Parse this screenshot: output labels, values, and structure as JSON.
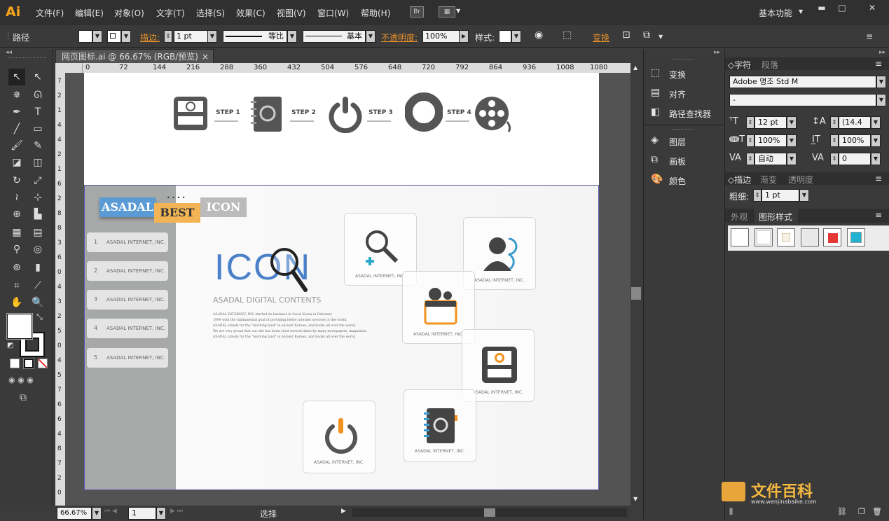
{
  "app": {
    "logo": "Ai"
  },
  "menu": [
    "文件(F)",
    "编辑(E)",
    "对象(O)",
    "文字(T)",
    "选择(S)",
    "效果(C)",
    "视图(V)",
    "窗口(W)",
    "帮助(H)"
  ],
  "toolbar_top": {
    "br": "Br",
    "workspace": "基本功能"
  },
  "control": {
    "selection": "路径",
    "stroke_label": "描边:",
    "stroke_value": "1 pt",
    "stroke_profile": "等比",
    "brush": "基本",
    "opacity_label": "不透明度:",
    "opacity_value": "100%",
    "style_label": "样式:",
    "transform": "变换"
  },
  "document": {
    "tab": "网页图标.ai @ 66.67% (RGB/预览)",
    "close": "×"
  },
  "ruler": {
    "h": [
      "0",
      "72",
      "144",
      "216",
      "288",
      "360",
      "432",
      "504",
      "576",
      "648",
      "720",
      "792",
      "864",
      "936",
      "1008",
      "1080"
    ],
    "v": [
      "7",
      "2",
      "1",
      "4",
      "4",
      "2",
      "1",
      "6",
      "2",
      "8",
      "8",
      "3",
      "6",
      "0",
      "4",
      "3",
      "2",
      "5",
      "0",
      "4",
      "5",
      "7",
      "6",
      "6",
      "4",
      "8",
      "7",
      "2",
      "0"
    ]
  },
  "artboard": {
    "steps": [
      "STEP 1",
      "STEP 2",
      "STEP 3",
      "STEP 4"
    ],
    "tabs": {
      "a": "ASADAL",
      "b": "BEST",
      "c": "ICON",
      "dots": "• • • •"
    },
    "list": [
      {
        "num": "1",
        "text": "ASADAL INTERNET, INC."
      },
      {
        "num": "2",
        "text": "ASADAL INTERNET, INC."
      },
      {
        "num": "3",
        "text": "ASADAL INTERNET, INC."
      },
      {
        "num": "4",
        "text": "ASADAL INTERNET, INC."
      },
      {
        "num": "5",
        "text": "ASADAL INTERNET, INC."
      }
    ],
    "hero_title": "ICON",
    "hero_subtitle": "ASADAL DIGITAL CONTENTS",
    "body": [
      "ASADAL INTERNET, INC started its business in Seoul Korea in February",
      "1999 with the fundamental goal of providing better internet services to the world.",
      "ASADAL stands for the \"morning land\" in ancient Korean,  and books all over the world.",
      "We are very proud that our site has been cited several times by many newspapers, magazines.",
      "ASADAL stands for the \"morning land\" in ancient Korean,  and books all over the world."
    ],
    "card_label": "ASADAL INTERNET, INC."
  },
  "right_panel1": {
    "items": [
      "变换",
      "对齐",
      "路径查找器",
      "图层",
      "画板",
      "颜色"
    ]
  },
  "char_panel": {
    "tabs": [
      "字符",
      "段落"
    ],
    "font": "Adobe 명조 Std M",
    "style": "-",
    "size": "12 pt",
    "leading": "(14.4",
    "vscale": "100%",
    "hscale": "100%",
    "kerning": "自动",
    "tracking": "0"
  },
  "stroke_panel": {
    "tabs": [
      "描边",
      "渐变",
      "透明度"
    ],
    "weight_label": "粗细:",
    "weight": "1 pt"
  },
  "style_panel": {
    "tabs": [
      "外观",
      "图形样式"
    ],
    "swatches": [
      "#ffffff",
      "#ffffff",
      "#f7f0e4",
      "#e8e8e8",
      "#e53935",
      "#1fb3d1"
    ]
  },
  "status": {
    "zoom": "66.67%",
    "page": "1",
    "mode": "选择"
  },
  "watermark": {
    "text": "文件百科",
    "url": "www.wenjinabaike.com"
  }
}
